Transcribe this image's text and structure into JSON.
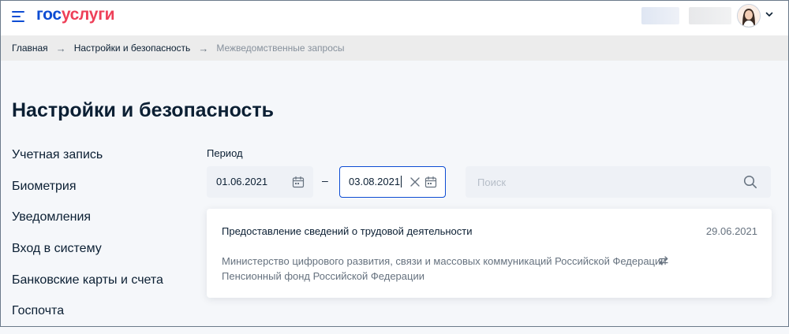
{
  "header": {
    "logo_part1": "гос",
    "logo_part2": "услуги"
  },
  "breadcrumb": [
    "Главная",
    "Настройки и безопасность",
    "Межведомственные запросы"
  ],
  "page_title": "Настройки и безопасность",
  "sidebar": {
    "items": [
      "Учетная запись",
      "Биометрия",
      "Уведомления",
      "Вход в систему",
      "Банковские карты и счета",
      "Госпочта"
    ]
  },
  "filter": {
    "period_label": "Период",
    "date_from": "01.06.2021",
    "date_separator": "–",
    "date_to": "03.08.2021",
    "search_placeholder": "Поиск"
  },
  "requests": [
    {
      "title": "Предоставление сведений о трудовой деятельности",
      "date": "29.06.2021",
      "from": "Министерство цифрового развития, связи и массовых коммуникаций Российской Федерации",
      "to": "Пенсионный фонд Российской Федерации"
    }
  ],
  "icons": {
    "menu": "burger-menu-icon",
    "calendar": "calendar-icon",
    "clear": "close-icon",
    "search": "search-icon",
    "exchange": "exchange-arrows-icon",
    "breadcrumb_separator": "arrow-right-icon",
    "profile_dropdown": "chevron-down-icon"
  },
  "colors": {
    "brand_blue": "#0d4cd3",
    "brand_red": "#ee3f58",
    "text_primary": "#0b1f33",
    "text_secondary": "#66727f",
    "page_bg": "#f5f7fa",
    "input_bg": "#eef1f6"
  }
}
